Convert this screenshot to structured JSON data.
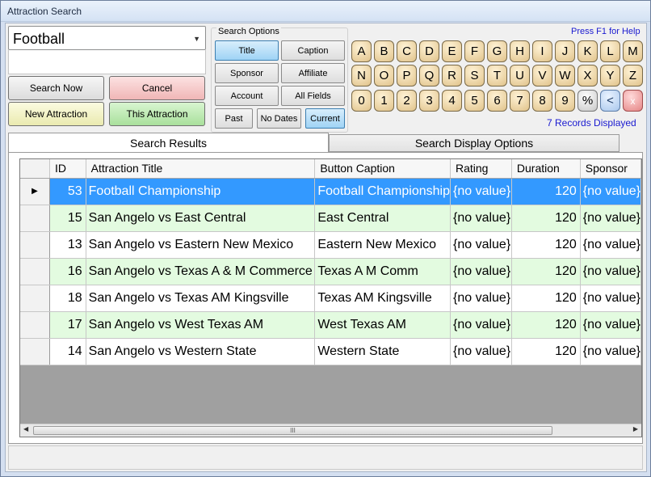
{
  "window": {
    "title": "Attraction Search"
  },
  "combo": {
    "value": "Football"
  },
  "buttons": {
    "search_now": "Search Now",
    "cancel": "Cancel",
    "new_attraction": "New Attraction",
    "this_attraction": "This Attraction"
  },
  "search_options": {
    "legend": "Search Options",
    "title": "Title",
    "caption": "Caption",
    "sponsor": "Sponsor",
    "affiliate": "Affiliate",
    "account": "Account",
    "all_fields": "All Fields",
    "past": "Past",
    "no_dates": "No Dates",
    "current": "Current",
    "selected": [
      "Title",
      "Current"
    ]
  },
  "help": {
    "text": "Press F1 for Help"
  },
  "keyboard": {
    "row1": [
      "A",
      "B",
      "C",
      "D",
      "E",
      "F",
      "G",
      "H",
      "I",
      "J",
      "K",
      "L",
      "M"
    ],
    "row2": [
      "N",
      "O",
      "P",
      "Q",
      "R",
      "S",
      "T",
      "U",
      "V",
      "W",
      "X",
      "Y",
      "Z"
    ],
    "row3": [
      "0",
      "1",
      "2",
      "3",
      "4",
      "5",
      "6",
      "7",
      "8",
      "9"
    ],
    "percent": "%",
    "backspace": "<",
    "clear": "x"
  },
  "records": {
    "text": "7 Records Displayed"
  },
  "tabs": {
    "results": "Search Results",
    "display_options": "Search Display Options"
  },
  "grid": {
    "columns": {
      "id": "ID",
      "title": "Attraction Title",
      "caption": "Button Caption",
      "rating": "Rating",
      "duration": "Duration",
      "sponsor": "Sponsor"
    },
    "rows": [
      {
        "id": "53",
        "title": "Football Championship",
        "caption": "Football Championship",
        "rating": "{no value}",
        "duration": "120",
        "sponsor": "{no value}"
      },
      {
        "id": "15",
        "title": "San Angelo vs East Central",
        "caption": "East Central",
        "rating": "{no value}",
        "duration": "120",
        "sponsor": "{no value}"
      },
      {
        "id": "13",
        "title": "San Angelo vs Eastern New Mexico",
        "caption": "Eastern New Mexico",
        "rating": "{no value}",
        "duration": "120",
        "sponsor": "{no value}"
      },
      {
        "id": "16",
        "title": "San Angelo vs Texas A & M Commerce",
        "caption": "Texas A M Comm",
        "rating": "{no value}",
        "duration": "120",
        "sponsor": "{no value}"
      },
      {
        "id": "18",
        "title": "San Angelo vs Texas AM Kingsville",
        "caption": "Texas AM Kingsville",
        "rating": "{no value}",
        "duration": "120",
        "sponsor": "{no value}"
      },
      {
        "id": "17",
        "title": "San Angelo vs West Texas AM",
        "caption": "West Texas AM",
        "rating": "{no value}",
        "duration": "120",
        "sponsor": "{no value}"
      },
      {
        "id": "14",
        "title": "San Angelo vs Western State",
        "caption": "Western State",
        "rating": "{no value}",
        "duration": "120",
        "sponsor": "{no value}"
      }
    ]
  },
  "scrollbar": {
    "grip": "III"
  }
}
